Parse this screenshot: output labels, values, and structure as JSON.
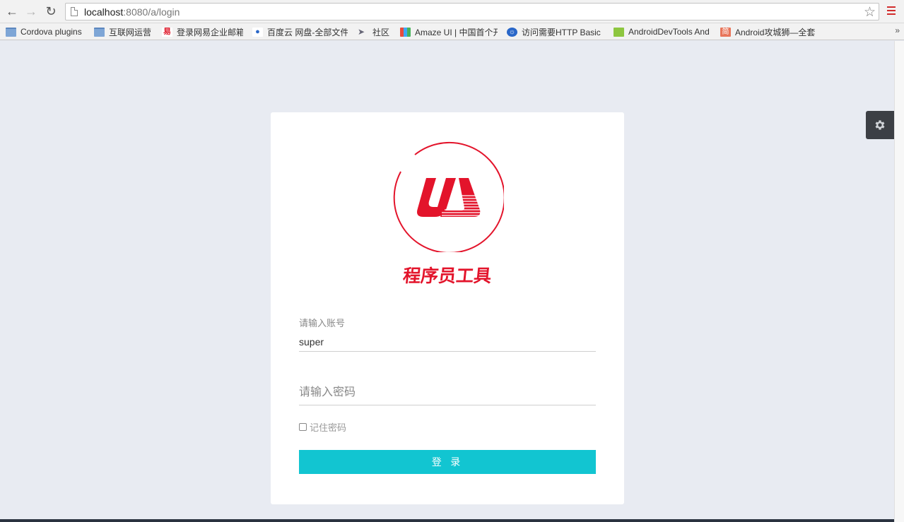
{
  "browser": {
    "url_host": "localhost",
    "url_rest": ":8080/a/login",
    "bookmarks": [
      {
        "label": "Cordova plugins",
        "icon": "folder-icon"
      },
      {
        "label": "互联网运营",
        "icon": "folder-icon"
      },
      {
        "label": "登录网易企业邮箱",
        "icon": "netease-icon"
      },
      {
        "label": "百度云 网盘-全部文件",
        "icon": "baidu-cloud-icon"
      },
      {
        "label": "社区",
        "icon": "paper-plane-icon"
      },
      {
        "label": "Amaze UI | 中国首个开",
        "icon": "amaze-ui-icon"
      },
      {
        "label": "访问需要HTTP Basic",
        "icon": "globe-icon"
      },
      {
        "label": "AndroidDevTools And",
        "icon": "android-icon"
      },
      {
        "label": "Android攻城狮—全套",
        "icon": "jianshu-icon"
      }
    ],
    "more_label": "»"
  },
  "login": {
    "brand": "程序员工具",
    "account_label": "请输入账号",
    "account_value": "super",
    "password_placeholder": "请输入密码",
    "remember_label": "记住密码",
    "remember_checked": false,
    "submit_label": "登 录"
  },
  "colors": {
    "brand_red": "#e3142b",
    "button_cyan": "#12c5d1",
    "page_bg": "#e8ebf2"
  }
}
